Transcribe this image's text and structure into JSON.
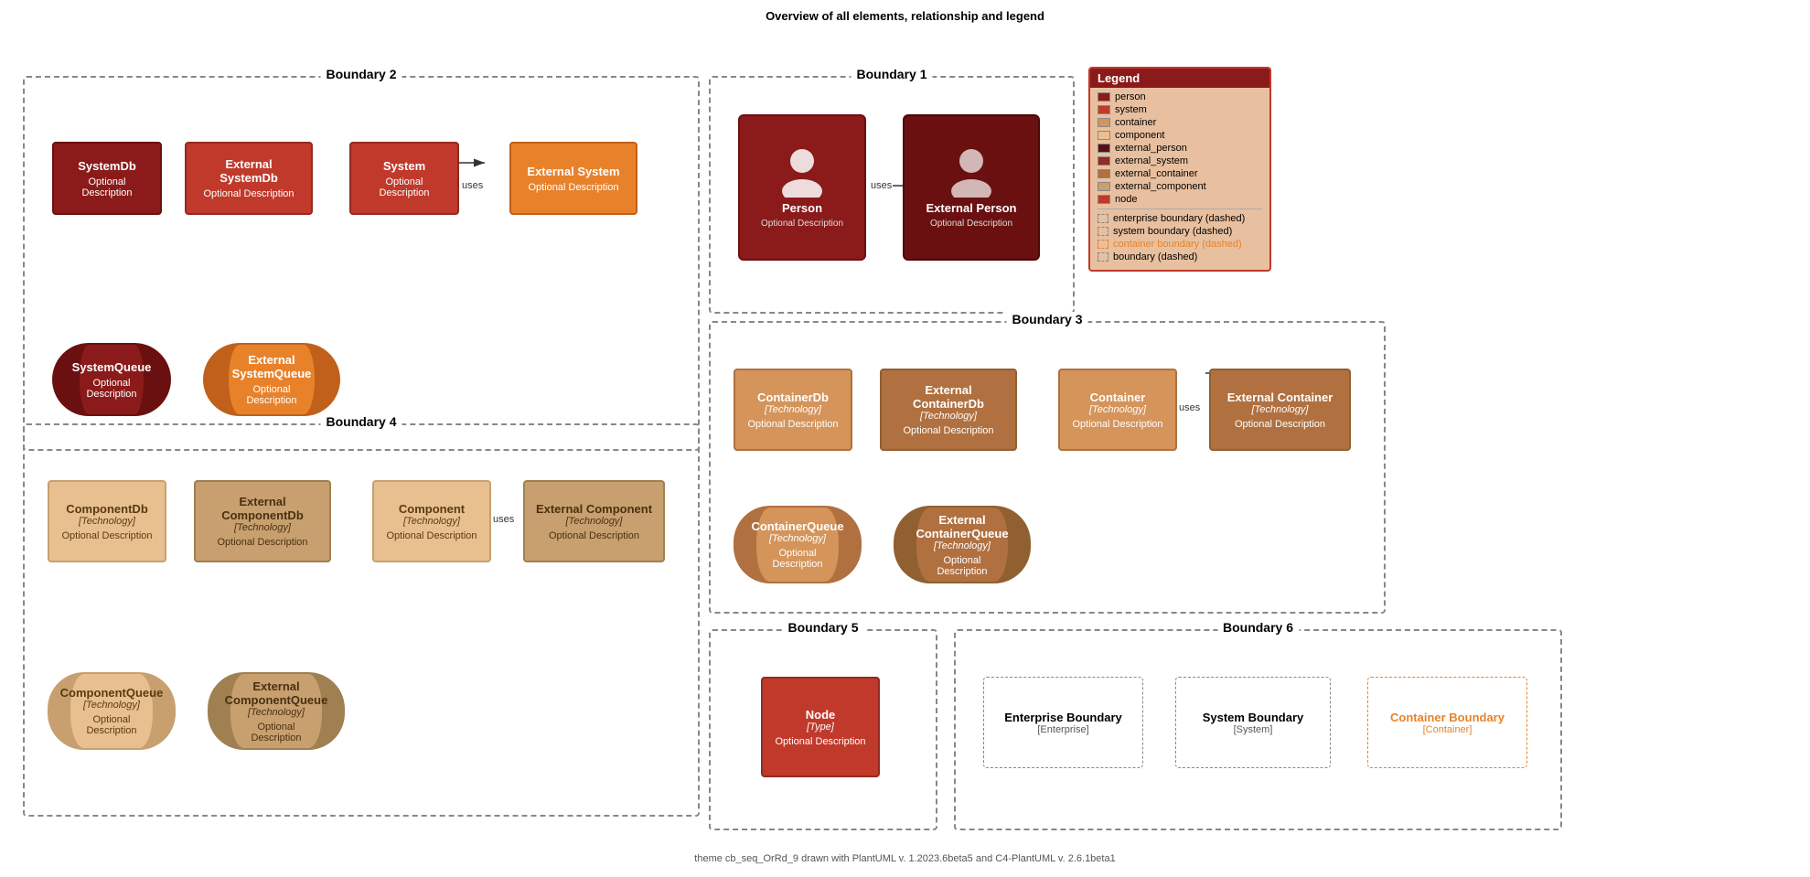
{
  "page": {
    "title": "Overview of all elements, relationship and legend",
    "footer": "theme cb_seq_OrRd_9 drawn with PlantUML v. 1.2023.6beta5 and C4-PlantUML v. 2.6.1beta1"
  },
  "boundaries": {
    "b1": {
      "title": "Boundary 1"
    },
    "b2": {
      "title": "Boundary 2"
    },
    "b3": {
      "title": "Boundary 3"
    },
    "b4": {
      "title": "Boundary 4"
    },
    "b5": {
      "title": "Boundary 5"
    },
    "b6": {
      "title": "Boundary 6"
    }
  },
  "elements": {
    "systemDb": {
      "title": "SystemDb",
      "desc": "Optional Description"
    },
    "externalSystemDb": {
      "title": "External SystemDb",
      "desc": "Optional Description"
    },
    "system": {
      "title": "System",
      "desc": "Optional Description"
    },
    "externalSystem": {
      "title": "External System",
      "desc": "Optional Description"
    },
    "systemQueue": {
      "title": "SystemQueue",
      "desc": "Optional Description"
    },
    "externalSystemQueue": {
      "title": "External SystemQueue",
      "desc": "Optional Description"
    },
    "person": {
      "title": "Person",
      "desc": "Optional Description"
    },
    "externalPerson": {
      "title": "External Person",
      "desc": "Optional Description"
    },
    "containerDb": {
      "title": "ContainerDb",
      "tech": "[Technology]",
      "desc": "Optional Description"
    },
    "externalContainerDb": {
      "title": "External ContainerDb",
      "tech": "[Technology]",
      "desc": "Optional Description"
    },
    "container": {
      "title": "Container",
      "tech": "[Technology]",
      "desc": "Optional Description"
    },
    "externalContainer": {
      "title": "External Container",
      "tech": "[Technology]",
      "desc": "Optional Description"
    },
    "containerQueue": {
      "title": "ContainerQueue",
      "tech": "[Technology]",
      "desc": "Optional Description"
    },
    "externalContainerQueue": {
      "title": "External ContainerQueue",
      "tech": "[Technology]",
      "desc": "Optional Description"
    },
    "componentDb": {
      "title": "ComponentDb",
      "tech": "[Technology]",
      "desc": "Optional Description"
    },
    "externalComponentDb": {
      "title": "External ComponentDb",
      "tech": "[Technology]",
      "desc": "Optional Description"
    },
    "component": {
      "title": "Component",
      "tech": "[Technology]",
      "desc": "Optional Description"
    },
    "externalComponent": {
      "title": "External Component",
      "tech": "[Technology]",
      "desc": "Optional Description"
    },
    "componentQueue": {
      "title": "ComponentQueue",
      "tech": "[Technology]",
      "desc": "Optional Description"
    },
    "externalComponentQueue": {
      "title": "External ComponentQueue",
      "tech": "[Technology]",
      "desc": "Optional Description"
    },
    "node": {
      "title": "Node",
      "tech": "[Type]",
      "desc": "Optional Description"
    }
  },
  "boundaryLabels": {
    "enterprise": {
      "title": "Enterprise Boundary",
      "sub": "[Enterprise]"
    },
    "system": {
      "title": "System Boundary",
      "sub": "[System]"
    },
    "container": {
      "title": "Container Boundary",
      "sub": "[Container]"
    }
  },
  "legend": {
    "title": "Legend",
    "items": [
      {
        "label": "person",
        "color": "#8B1A1A"
      },
      {
        "label": "system",
        "color": "#C0392B"
      },
      {
        "label": "container",
        "color": "#D4945A"
      },
      {
        "label": "component",
        "color": "#E8C090"
      },
      {
        "label": "external_person",
        "color": "#6B1010"
      },
      {
        "label": "external_system",
        "color": "#922B21"
      },
      {
        "label": "external_container",
        "color": "#B07040"
      },
      {
        "label": "external_component",
        "color": "#C8A070"
      },
      {
        "label": "node",
        "color": "#C0392B"
      }
    ],
    "borderItems": [
      {
        "label": "enterprise boundary (dashed)",
        "color": "#888",
        "isOrange": false
      },
      {
        "label": "system boundary (dashed)",
        "color": "#888",
        "isOrange": false
      },
      {
        "label": "container boundary (dashed)",
        "color": "#E8822A",
        "isOrange": true
      },
      {
        "label": "boundary (dashed)",
        "color": "#888",
        "isOrange": false
      }
    ]
  },
  "arrows": {
    "uses": "uses"
  }
}
